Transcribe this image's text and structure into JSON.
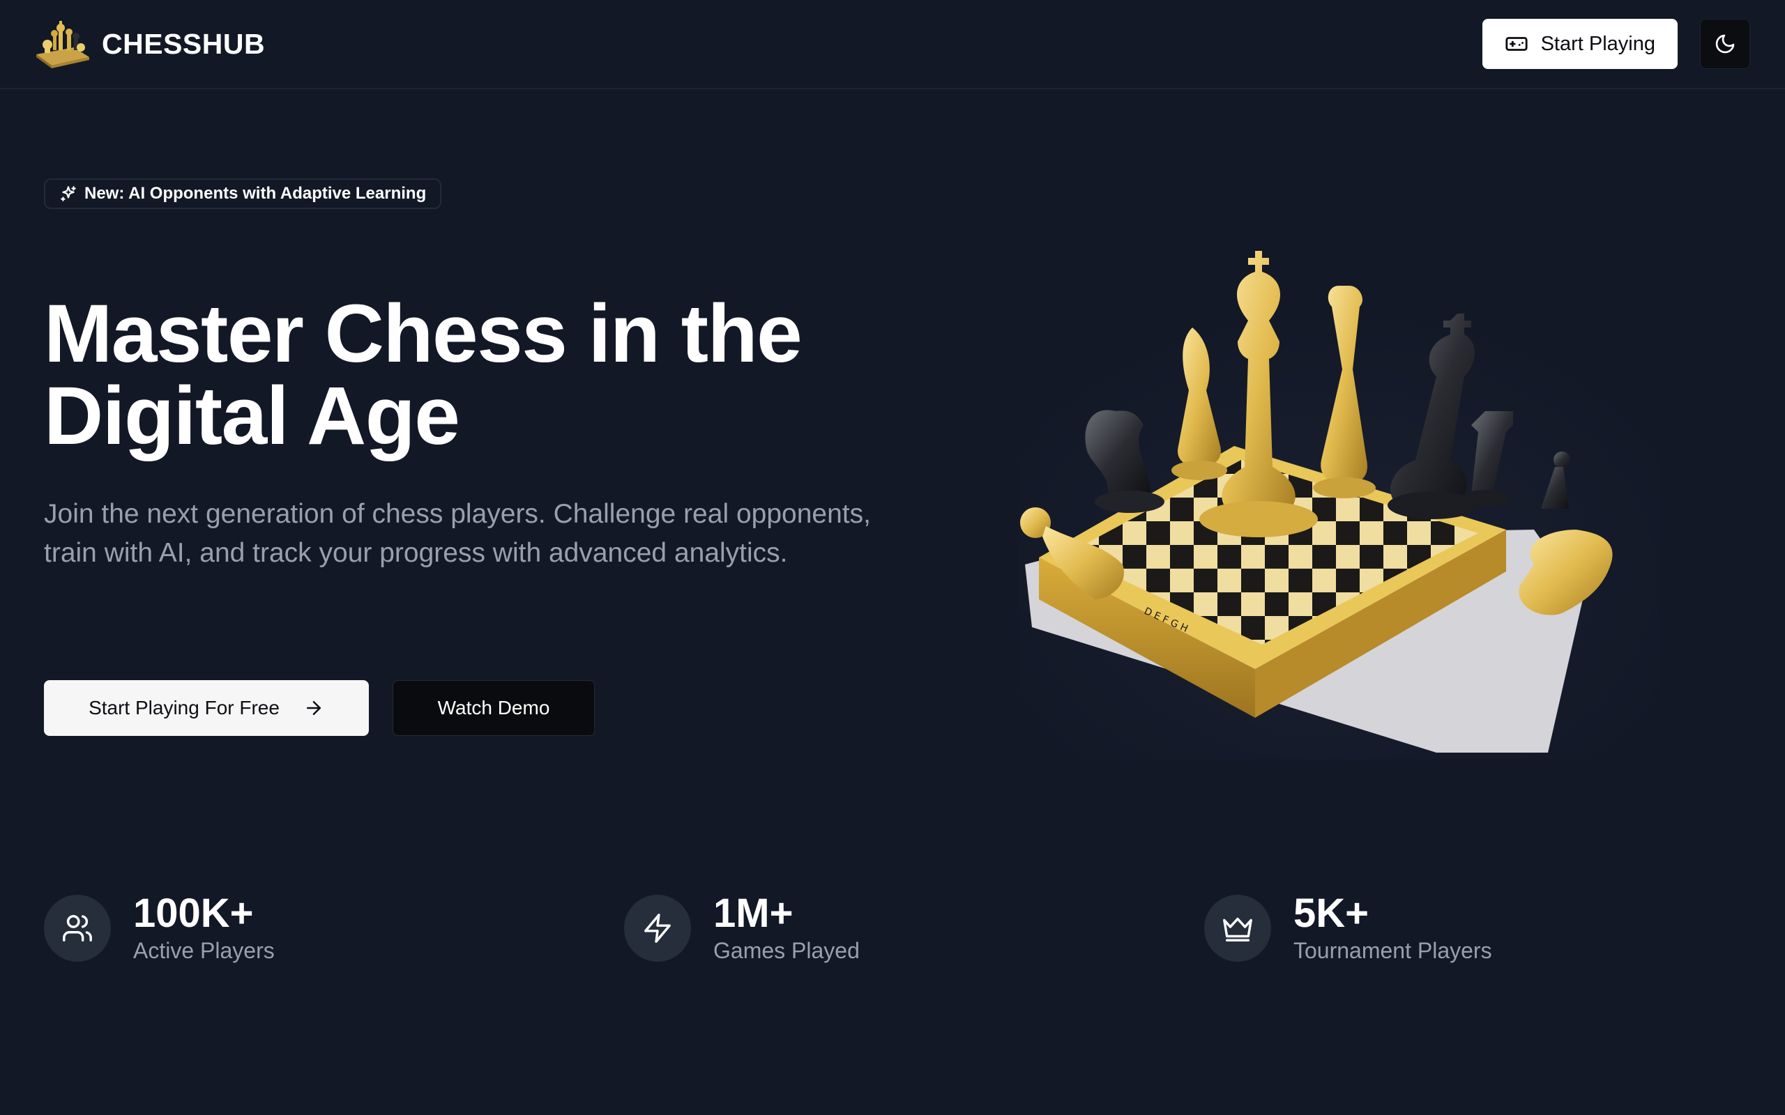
{
  "header": {
    "brand_name": "CHESSHUB",
    "start_playing_label": "Start Playing",
    "icons": {
      "start": "gamepad-icon",
      "theme": "moon-icon"
    }
  },
  "hero": {
    "badge_text": "New: AI Opponents with Adaptive Learning",
    "title_line1": "Master Chess in the",
    "title_line2": "Digital Age",
    "subtitle": "Join the next generation of chess players. Challenge real opponents, train with AI, and track your progress with advanced analytics.",
    "cta_primary_label": "Start Playing For Free",
    "cta_secondary_label": "Watch Demo"
  },
  "stats": [
    {
      "value": "100K+",
      "label": "Active Players",
      "icon": "users-icon"
    },
    {
      "value": "1M+",
      "label": "Games Played",
      "icon": "lightning-icon"
    },
    {
      "value": "5K+",
      "label": "Tournament Players",
      "icon": "crown-icon"
    }
  ],
  "colors": {
    "background": "#121826",
    "accent_gold": "#e8c250",
    "muted_text": "#9aa0ab"
  }
}
